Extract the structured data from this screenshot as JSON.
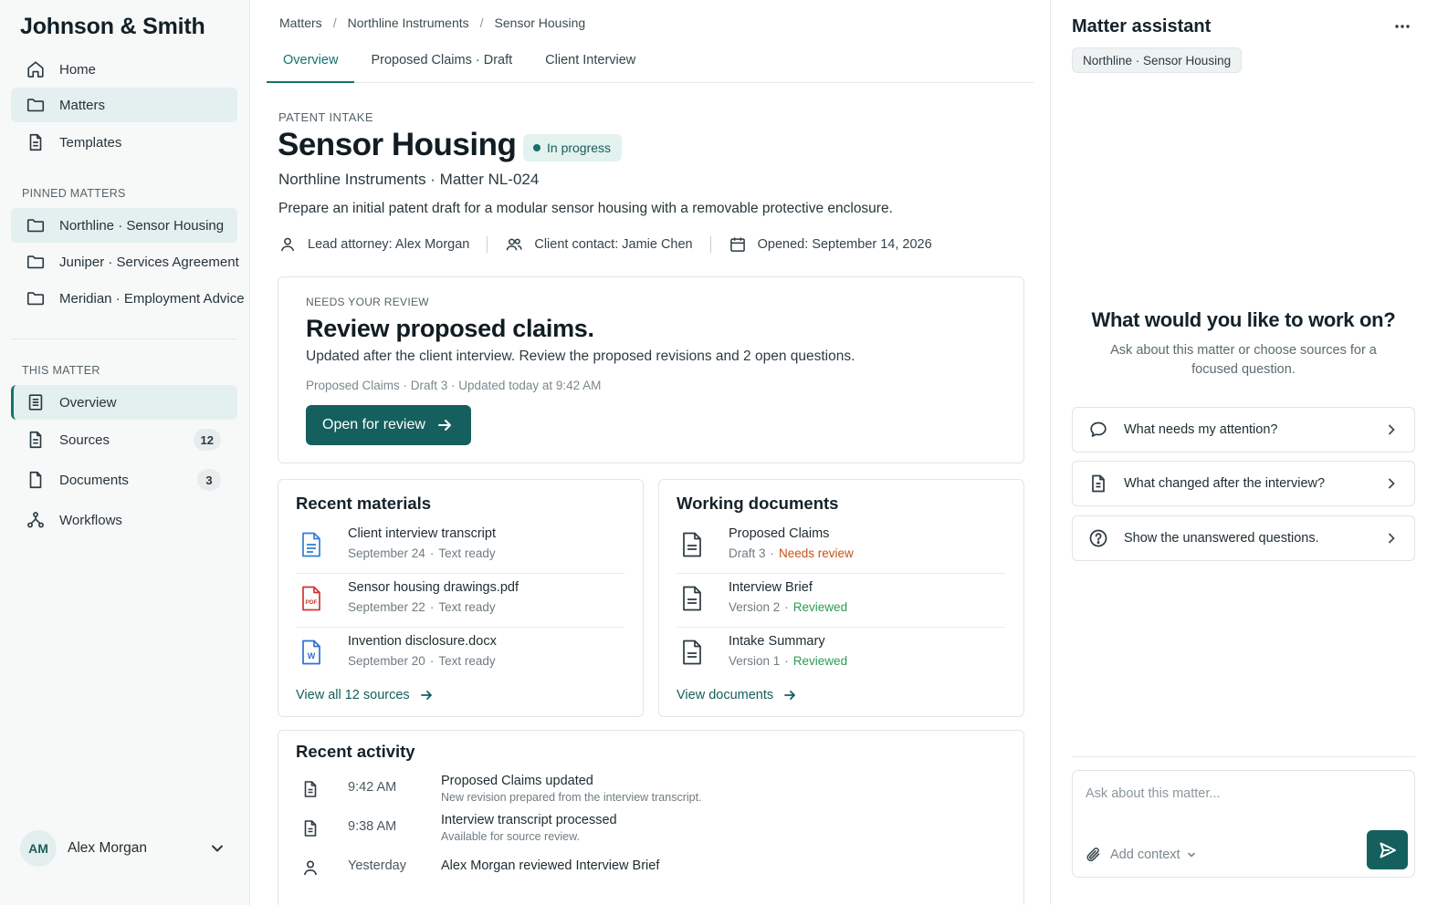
{
  "sidebar": {
    "brand": "Johnson & Smith",
    "nav": [
      {
        "label": "Home",
        "icon": "home-icon"
      },
      {
        "label": "Matters",
        "icon": "folder-icon"
      },
      {
        "label": "Templates",
        "icon": "document-icon"
      }
    ],
    "pinned_label": "PINNED MATTERS",
    "pinned": [
      {
        "label": "Northline · Sensor Housing"
      },
      {
        "label": "Juniper · Services Agreement"
      },
      {
        "label": "Meridian · Employment Advice"
      }
    ],
    "this_matter_label": "THIS MATTER",
    "this_matter": [
      {
        "label": "Overview",
        "icon": "overview-icon"
      },
      {
        "label": "Sources",
        "icon": "document-icon",
        "count": "12"
      },
      {
        "label": "Documents",
        "icon": "file-icon",
        "count": "3"
      },
      {
        "label": "Workflows",
        "icon": "workflow-icon"
      }
    ],
    "user": {
      "initials": "AM",
      "name": "Alex Morgan"
    }
  },
  "main": {
    "breadcrumbs": [
      "Matters",
      "Northline Instruments",
      "Sensor Housing"
    ],
    "tabs": [
      "Overview",
      "Proposed Claims · Draft",
      "Client Interview"
    ],
    "eyebrow": "PATENT INTAKE",
    "title": "Sensor Housing",
    "status": "In progress",
    "subline": "Northline Instruments · Matter NL-024",
    "description": "Prepare an initial patent draft for a modular sensor housing with a removable protective enclosure.",
    "meta": {
      "lead": "Lead attorney: Alex Morgan",
      "contact": "Client contact: Jamie Chen",
      "opened": "Opened: September 14, 2026"
    },
    "review": {
      "eyebrow": "NEEDS YOUR REVIEW",
      "title": "Review proposed claims.",
      "description": "Updated after the client interview. Review the proposed revisions and 2 open questions.",
      "meta": "Proposed Claims · Draft 3 · Updated today at 9:42 AM",
      "button": "Open for review"
    },
    "materials": {
      "title": "Recent materials",
      "items": [
        {
          "name": "Client interview transcript",
          "date": "September 24",
          "status": "Text ready",
          "icon": "text-file-icon"
        },
        {
          "name": "Sensor housing drawings.pdf",
          "date": "September 22",
          "status": "Text ready",
          "icon": "pdf-file-icon"
        },
        {
          "name": "Invention disclosure.docx",
          "date": "September 20",
          "status": "Text ready",
          "icon": "word-file-icon"
        }
      ],
      "link": "View all 12 sources"
    },
    "documents": {
      "title": "Working documents",
      "items": [
        {
          "name": "Proposed Claims",
          "version": "Draft 3",
          "status": "Needs review"
        },
        {
          "name": "Interview Brief",
          "version": "Version 2",
          "status": "Reviewed"
        },
        {
          "name": "Intake Summary",
          "version": "Version 1",
          "status": "Reviewed"
        }
      ],
      "link": "View documents"
    },
    "activity": {
      "title": "Recent activity",
      "items": [
        {
          "time": "9:42 AM",
          "title": "Proposed Claims updated",
          "desc": "New revision prepared from the interview transcript.",
          "icon": "document-icon"
        },
        {
          "time": "9:38 AM",
          "title": "Interview transcript processed",
          "desc": "Available for source review.",
          "icon": "document-icon"
        },
        {
          "time": "Yesterday",
          "title": "Alex Morgan reviewed Interview Brief",
          "desc": "",
          "icon": "person-icon"
        }
      ]
    }
  },
  "assistant": {
    "title": "Matter assistant",
    "chip": "Northline · Sensor Housing",
    "hero": "What would you like to work on?",
    "hero_sub": "Ask about this matter or choose sources for a focused question.",
    "suggestions": [
      {
        "label": "What needs my attention?",
        "icon": "chat-bubble-icon"
      },
      {
        "label": "What changed after the interview?",
        "icon": "document-icon"
      },
      {
        "label": "Show the unanswered questions.",
        "icon": "question-circle-icon"
      }
    ],
    "input_placeholder": "Ask about this matter...",
    "add_context": "Add context"
  },
  "colors": {
    "accent": "#15605e",
    "accent_light": "#e3f0ef",
    "warning": "#c95314",
    "success": "#2e9a57"
  }
}
